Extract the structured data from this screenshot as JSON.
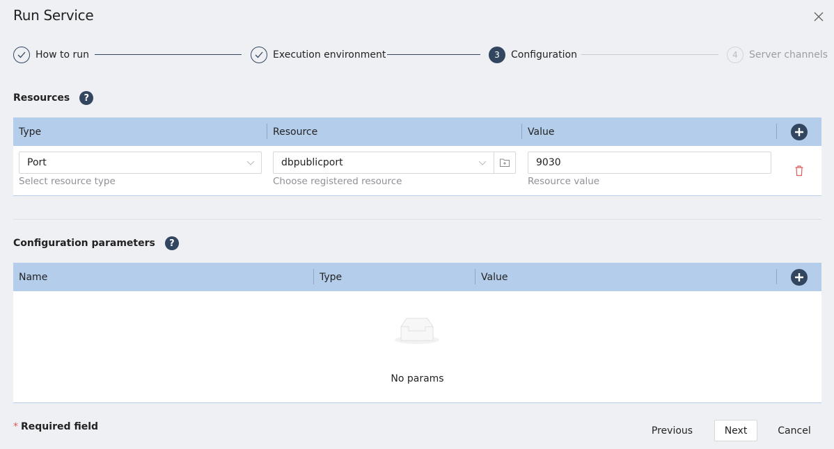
{
  "dialog": {
    "title": "Run Service",
    "close_icon": "close-icon"
  },
  "steps": [
    {
      "number": "1",
      "label": "How to run",
      "state": "done",
      "icon": "check-icon"
    },
    {
      "number": "2",
      "label": "Execution environment",
      "state": "done",
      "icon": "check-icon"
    },
    {
      "number": "3",
      "label": "Configuration",
      "state": "active"
    },
    {
      "number": "4",
      "label": "Server channels",
      "state": "pending"
    }
  ],
  "resources": {
    "title": "Resources",
    "help_icon": "?",
    "columns": [
      "Type",
      "Resource",
      "Value"
    ],
    "rows": [
      {
        "type": {
          "value": "Port",
          "hint": "Select resource type"
        },
        "resource": {
          "value": "dbpublicport",
          "hint": "Choose registered resource"
        },
        "value": {
          "value": "9030",
          "hint": "Resource value"
        }
      }
    ]
  },
  "config_params": {
    "title": "Configuration parameters",
    "help_icon": "?",
    "columns": [
      "Name",
      "Type",
      "Value"
    ],
    "empty_text": "No params"
  },
  "footer": {
    "required_star": "*",
    "required_label": "Required field",
    "previous_label": "Previous",
    "next_label": "Next",
    "cancel_label": "Cancel"
  },
  "colors": {
    "accent": "#33465f",
    "table_header": "#b4cdeb",
    "danger": "#e05a5a",
    "background": "#eff0f4"
  }
}
